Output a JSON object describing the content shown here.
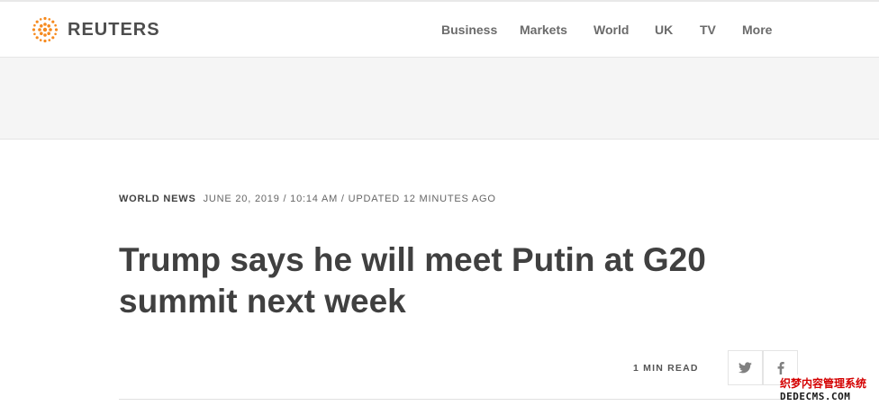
{
  "header": {
    "logo_text": "REUTERS",
    "logo_color": "#f68a1e",
    "nav": [
      {
        "label": "Business"
      },
      {
        "label": "Markets"
      },
      {
        "label": "World"
      },
      {
        "label": "UK"
      },
      {
        "label": "TV"
      },
      {
        "label": "More"
      }
    ]
  },
  "article": {
    "section": "WORLD NEWS",
    "dateline": "JUNE 20, 2019 / 10:14 AM / UPDATED 12 MINUTES AGO",
    "headline": "Trump says he will meet Putin at G20 summit next week",
    "read_time": "1 MIN READ",
    "share": [
      {
        "icon": "twitter-icon"
      },
      {
        "icon": "facebook-icon"
      }
    ]
  },
  "watermark": {
    "line1": "织梦内容管理系统",
    "line2": "DEDECMS.COM",
    "accent": "#d40000"
  }
}
